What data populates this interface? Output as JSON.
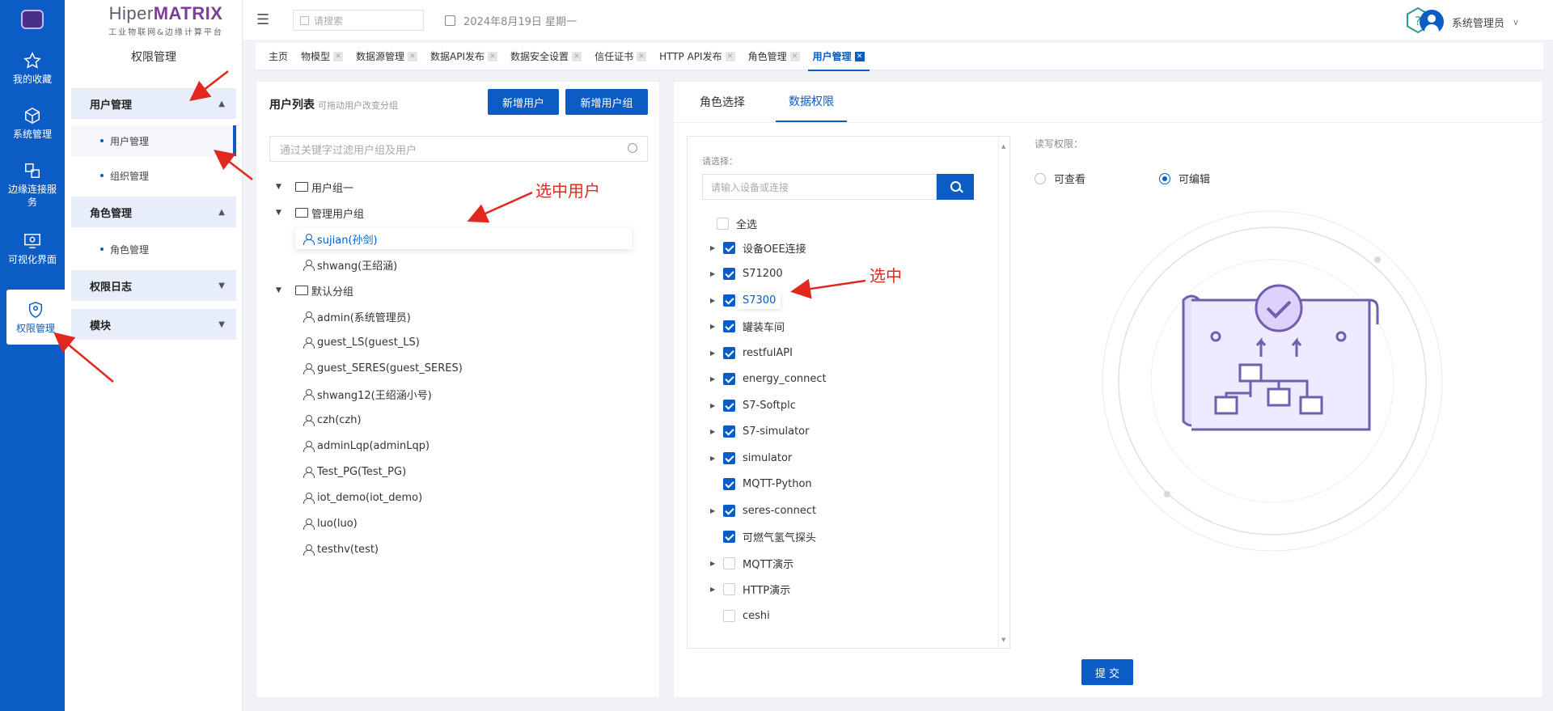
{
  "brand": {
    "name_part1": "Hiper",
    "name_part2": "MATRIX",
    "subtitle": "工业物联网&边缘计算平台"
  },
  "iconbar": {
    "items": [
      {
        "label": "我的收藏",
        "icon": "star-icon"
      },
      {
        "label": "系统管理",
        "icon": "cube-icon"
      },
      {
        "label": "边缘连接服务",
        "icon": "link-icon"
      },
      {
        "label": "可视化界面",
        "icon": "monitor-eye-icon"
      },
      {
        "label": "权限管理",
        "icon": "shield-location-icon"
      }
    ]
  },
  "submenu": {
    "title": "权限管理",
    "groups": [
      {
        "label": "用户管理",
        "items": [
          "用户管理",
          "组织管理"
        ]
      },
      {
        "label": "角色管理",
        "items": [
          "角色管理"
        ]
      },
      {
        "label": "权限日志",
        "items": []
      },
      {
        "label": "模块",
        "items": []
      }
    ]
  },
  "topbar": {
    "search_placeholder": "请搜索",
    "date": "2024年8月19日 星期一",
    "user": "系统管理员"
  },
  "tabs": [
    "主页",
    "物模型",
    "数据源管理",
    "数据API发布",
    "数据安全设置",
    "信任证书",
    "HTTP API发布",
    "角色管理",
    "用户管理"
  ],
  "user_panel": {
    "title": "用户列表",
    "hint": "可拖动用户改变分组",
    "add_user": "新增用户",
    "add_group": "新增用户组",
    "filter_placeholder": "通过关键字过滤用户组及用户",
    "tree": [
      {
        "type": "group",
        "label": "用户组一",
        "expanded": false
      },
      {
        "type": "group",
        "label": "管理用户组",
        "expanded": true
      },
      {
        "type": "user",
        "label": "sujian(孙剑)",
        "selected": true
      },
      {
        "type": "user",
        "label": "shwang(王绍涵)"
      },
      {
        "type": "group",
        "label": "默认分组",
        "expanded": true
      },
      {
        "type": "user",
        "label": "admin(系统管理员)"
      },
      {
        "type": "user",
        "label": "guest_LS(guest_LS)"
      },
      {
        "type": "user",
        "label": "guest_SERES(guest_SERES)"
      },
      {
        "type": "user",
        "label": "shwang12(王绍涵小号)"
      },
      {
        "type": "user",
        "label": "czh(czh)"
      },
      {
        "type": "user",
        "label": "adminLqp(adminLqp)"
      },
      {
        "type": "user",
        "label": "Test_PG(Test_PG)"
      },
      {
        "type": "user",
        "label": "iot_demo(iot_demo)"
      },
      {
        "type": "user",
        "label": "luo(luo)"
      },
      {
        "type": "user",
        "label": "testhv(test)"
      }
    ]
  },
  "perm_panel": {
    "tabs": [
      "角色选择",
      "数据权限"
    ],
    "select_label": "请选择：",
    "device_placeholder": "请输入设备或连接",
    "select_all": "全选",
    "devices": [
      {
        "label": "设备OEE连接",
        "checked": true,
        "expandable": true
      },
      {
        "label": "S71200",
        "checked": true,
        "expandable": true
      },
      {
        "label": "S7300",
        "checked": true,
        "expandable": true,
        "highlight": true
      },
      {
        "label": "罐装车间",
        "checked": true,
        "expandable": true
      },
      {
        "label": "restfulAPI",
        "checked": true,
        "expandable": true
      },
      {
        "label": "energy_connect",
        "checked": true,
        "expandable": true
      },
      {
        "label": "S7-Softplc",
        "checked": true,
        "expandable": true
      },
      {
        "label": "S7-simulator",
        "checked": true,
        "expandable": true
      },
      {
        "label": "simulator",
        "checked": true,
        "expandable": true
      },
      {
        "label": "MQTT-Python",
        "checked": true,
        "expandable": false
      },
      {
        "label": "seres-connect",
        "checked": true,
        "expandable": true
      },
      {
        "label": "可燃气氢气探头",
        "checked": true,
        "expandable": false
      },
      {
        "label": "MQTT演示",
        "checked": false,
        "expandable": true
      },
      {
        "label": "HTTP演示",
        "checked": false,
        "expandable": true
      },
      {
        "label": "ceshi",
        "checked": false,
        "expandable": false
      }
    ],
    "rw_label": "读写权限：",
    "radio_view": "可查看",
    "radio_edit": "可编辑",
    "submit": "提 交"
  },
  "annotations": {
    "select_user": "选中用户",
    "selected": "选中"
  },
  "colors": {
    "primary": "#0b5cc4",
    "annotation": "#e0281f",
    "brand_accent": "#7d3d9a"
  }
}
